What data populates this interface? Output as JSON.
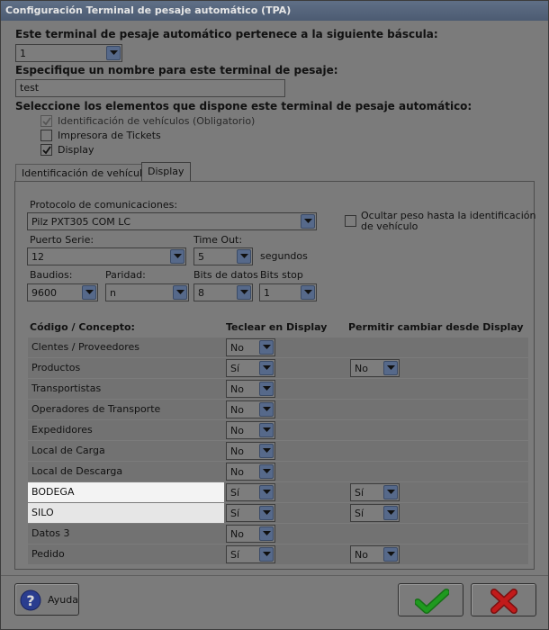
{
  "window": {
    "title": "Configuración Terminal de pesaje automático (TPA)"
  },
  "scale": {
    "label": "Este terminal de pesaje automático pertenece a la siguiente báscula:",
    "value": "1"
  },
  "name": {
    "label": "Especifique un nombre para este terminal de pesaje:",
    "value": "test"
  },
  "elements": {
    "label": "Seleccione los elementos que dispone este terminal de pesaje automático:",
    "items": [
      {
        "label": "Identificación de vehículos (Obligatorio)",
        "checked": true,
        "disabled": true
      },
      {
        "label": "Impresora de Tickets",
        "checked": false,
        "disabled": false
      },
      {
        "label": "Display",
        "checked": true,
        "disabled": false
      }
    ]
  },
  "tabs": [
    {
      "label": "Identificación de vehículos",
      "active": false
    },
    {
      "label": "Display",
      "active": true
    }
  ],
  "display": {
    "protocol_label": "Protocolo de comunicaciones:",
    "protocol_value": "Pilz PXT305 COM LC",
    "hide_weight_label_1": "Ocultar peso hasta la identificación",
    "hide_weight_label_2": "de vehículo",
    "port_label": "Puerto Serie:",
    "port_value": "12",
    "timeout_label": "Time Out:",
    "timeout_value": "5",
    "timeout_unit": "segundos",
    "baud_label": "Baudios:",
    "baud_value": "9600",
    "parity_label": "Paridad:",
    "parity_value": "n",
    "databits_label": "Bits de datos",
    "databits_value": "8",
    "stopbits_label": "Bits stop",
    "stopbits_value": "1"
  },
  "table": {
    "headers": [
      "Código / Concepto:",
      "Teclear en Display",
      "Permitir cambiar desde Display"
    ],
    "rows": [
      {
        "concept": "Clentes / Proveedores",
        "type": "No",
        "change": ""
      },
      {
        "concept": "Productos",
        "type": "Sí",
        "change": "No"
      },
      {
        "concept": "Transportistas",
        "type": "No",
        "change": ""
      },
      {
        "concept": "Operadores de Transporte",
        "type": "No",
        "change": ""
      },
      {
        "concept": "Expedidores",
        "type": "No",
        "change": ""
      },
      {
        "concept": "Local de Carga",
        "type": "No",
        "change": ""
      },
      {
        "concept": "Local de Descarga",
        "type": "No",
        "change": ""
      },
      {
        "concept": "BODEGA",
        "type": "Sí",
        "change": "Sí"
      },
      {
        "concept": "SILO",
        "type": "Sí",
        "change": "Sí"
      },
      {
        "concept": "Datos 3",
        "type": "No",
        "change": ""
      },
      {
        "concept": "Pedido",
        "type": "Sí",
        "change": "No"
      }
    ]
  },
  "footer": {
    "help_label": "Ayuda"
  },
  "colors": {
    "ok": "#1f9a1f",
    "cancel": "#c21a1a",
    "help": "#2a3d8f"
  }
}
